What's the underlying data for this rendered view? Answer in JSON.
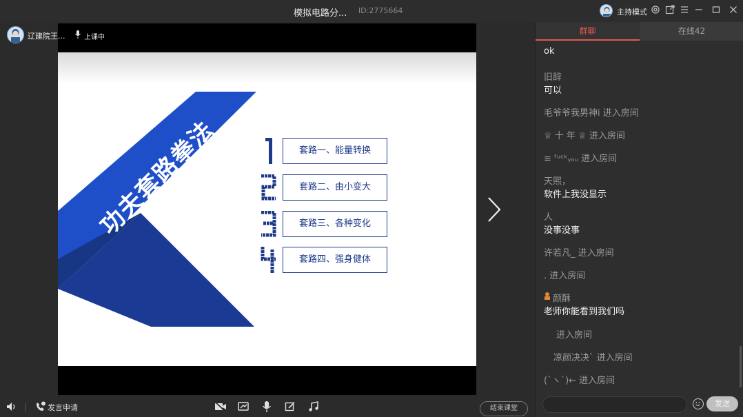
{
  "window": {
    "title": "模拟电路分...",
    "room_id": "ID:2775664",
    "host_mode_label": "主持模式"
  },
  "presenter": {
    "name": "辽建院王...",
    "status": "上课中"
  },
  "slide": {
    "banner_title": "功夫套路拳法",
    "items": [
      {
        "number": "1",
        "label": "套路一、能量转换"
      },
      {
        "number": "2",
        "label": "套路二、由小变大"
      },
      {
        "number": "3",
        "label": "套路三、各种变化"
      },
      {
        "number": "4",
        "label": "套路四、强身健体"
      }
    ]
  },
  "chat": {
    "tabs": [
      {
        "label": "群聊",
        "active": true
      },
      {
        "label": "在线42",
        "active": false
      }
    ],
    "messages": [
      {
        "type": "text",
        "text": "ok"
      },
      {
        "type": "user",
        "name": "旧辞",
        "text": "可以"
      },
      {
        "type": "system",
        "text": "毛爷爷我男神i 进入房间"
      },
      {
        "type": "system",
        "text": "♕ 十 年 ♕ 进入房间"
      },
      {
        "type": "system",
        "text": "≡ ᶠᵘᶜᵏᵧₒᵤ 进入房间"
      },
      {
        "type": "user",
        "name": "天煕，",
        "text": "软件上我没显示"
      },
      {
        "type": "user",
        "name": "人",
        "text": "没事没事"
      },
      {
        "type": "system",
        "text": "许若凡_ 进入房间"
      },
      {
        "type": "system",
        "text": ". 进入房间"
      },
      {
        "type": "user",
        "name": "颜酥",
        "text": "老师你能看到我们吗"
      },
      {
        "type": "system",
        "text": "进入房间"
      },
      {
        "type": "system",
        "text": "凉颜决决` 进入房间"
      },
      {
        "type": "system",
        "text": "(`ヽ`)← 进入房间"
      }
    ],
    "send_label": "发送"
  },
  "bottom": {
    "apply_label": "发言申请",
    "end_label": "结束课堂"
  },
  "colors": {
    "slide_blue": "#1e3a8a",
    "accent_red": "#e05a4e"
  }
}
